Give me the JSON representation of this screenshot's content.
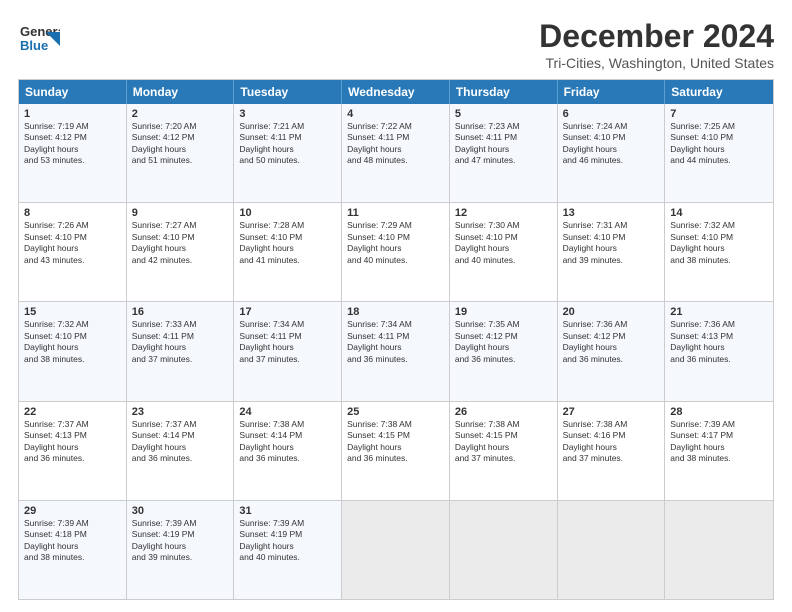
{
  "header": {
    "logo_general": "General",
    "logo_blue": "Blue",
    "main_title": "December 2024",
    "subtitle": "Tri-Cities, Washington, United States"
  },
  "calendar": {
    "days_of_week": [
      "Sunday",
      "Monday",
      "Tuesday",
      "Wednesday",
      "Thursday",
      "Friday",
      "Saturday"
    ],
    "rows": [
      [
        {
          "day": "1",
          "sunrise": "7:19 AM",
          "sunset": "4:12 PM",
          "daylight": "8 hours and 53 minutes."
        },
        {
          "day": "2",
          "sunrise": "7:20 AM",
          "sunset": "4:12 PM",
          "daylight": "8 hours and 51 minutes."
        },
        {
          "day": "3",
          "sunrise": "7:21 AM",
          "sunset": "4:11 PM",
          "daylight": "8 hours and 50 minutes."
        },
        {
          "day": "4",
          "sunrise": "7:22 AM",
          "sunset": "4:11 PM",
          "daylight": "8 hours and 48 minutes."
        },
        {
          "day": "5",
          "sunrise": "7:23 AM",
          "sunset": "4:11 PM",
          "daylight": "8 hours and 47 minutes."
        },
        {
          "day": "6",
          "sunrise": "7:24 AM",
          "sunset": "4:10 PM",
          "daylight": "8 hours and 46 minutes."
        },
        {
          "day": "7",
          "sunrise": "7:25 AM",
          "sunset": "4:10 PM",
          "daylight": "8 hours and 44 minutes."
        }
      ],
      [
        {
          "day": "8",
          "sunrise": "7:26 AM",
          "sunset": "4:10 PM",
          "daylight": "8 hours and 43 minutes."
        },
        {
          "day": "9",
          "sunrise": "7:27 AM",
          "sunset": "4:10 PM",
          "daylight": "8 hours and 42 minutes."
        },
        {
          "day": "10",
          "sunrise": "7:28 AM",
          "sunset": "4:10 PM",
          "daylight": "8 hours and 41 minutes."
        },
        {
          "day": "11",
          "sunrise": "7:29 AM",
          "sunset": "4:10 PM",
          "daylight": "8 hours and 40 minutes."
        },
        {
          "day": "12",
          "sunrise": "7:30 AM",
          "sunset": "4:10 PM",
          "daylight": "8 hours and 40 minutes."
        },
        {
          "day": "13",
          "sunrise": "7:31 AM",
          "sunset": "4:10 PM",
          "daylight": "8 hours and 39 minutes."
        },
        {
          "day": "14",
          "sunrise": "7:32 AM",
          "sunset": "4:10 PM",
          "daylight": "8 hours and 38 minutes."
        }
      ],
      [
        {
          "day": "15",
          "sunrise": "7:32 AM",
          "sunset": "4:10 PM",
          "daylight": "8 hours and 38 minutes."
        },
        {
          "day": "16",
          "sunrise": "7:33 AM",
          "sunset": "4:11 PM",
          "daylight": "8 hours and 37 minutes."
        },
        {
          "day": "17",
          "sunrise": "7:34 AM",
          "sunset": "4:11 PM",
          "daylight": "8 hours and 37 minutes."
        },
        {
          "day": "18",
          "sunrise": "7:34 AM",
          "sunset": "4:11 PM",
          "daylight": "8 hours and 36 minutes."
        },
        {
          "day": "19",
          "sunrise": "7:35 AM",
          "sunset": "4:12 PM",
          "daylight": "8 hours and 36 minutes."
        },
        {
          "day": "20",
          "sunrise": "7:36 AM",
          "sunset": "4:12 PM",
          "daylight": "8 hours and 36 minutes."
        },
        {
          "day": "21",
          "sunrise": "7:36 AM",
          "sunset": "4:13 PM",
          "daylight": "8 hours and 36 minutes."
        }
      ],
      [
        {
          "day": "22",
          "sunrise": "7:37 AM",
          "sunset": "4:13 PM",
          "daylight": "8 hours and 36 minutes."
        },
        {
          "day": "23",
          "sunrise": "7:37 AM",
          "sunset": "4:14 PM",
          "daylight": "8 hours and 36 minutes."
        },
        {
          "day": "24",
          "sunrise": "7:38 AM",
          "sunset": "4:14 PM",
          "daylight": "8 hours and 36 minutes."
        },
        {
          "day": "25",
          "sunrise": "7:38 AM",
          "sunset": "4:15 PM",
          "daylight": "8 hours and 36 minutes."
        },
        {
          "day": "26",
          "sunrise": "7:38 AM",
          "sunset": "4:15 PM",
          "daylight": "8 hours and 37 minutes."
        },
        {
          "day": "27",
          "sunrise": "7:38 AM",
          "sunset": "4:16 PM",
          "daylight": "8 hours and 37 minutes."
        },
        {
          "day": "28",
          "sunrise": "7:39 AM",
          "sunset": "4:17 PM",
          "daylight": "8 hours and 38 minutes."
        }
      ],
      [
        {
          "day": "29",
          "sunrise": "7:39 AM",
          "sunset": "4:18 PM",
          "daylight": "8 hours and 38 minutes."
        },
        {
          "day": "30",
          "sunrise": "7:39 AM",
          "sunset": "4:19 PM",
          "daylight": "8 hours and 39 minutes."
        },
        {
          "day": "31",
          "sunrise": "7:39 AM",
          "sunset": "4:19 PM",
          "daylight": "8 hours and 40 minutes."
        },
        null,
        null,
        null,
        null
      ]
    ]
  }
}
